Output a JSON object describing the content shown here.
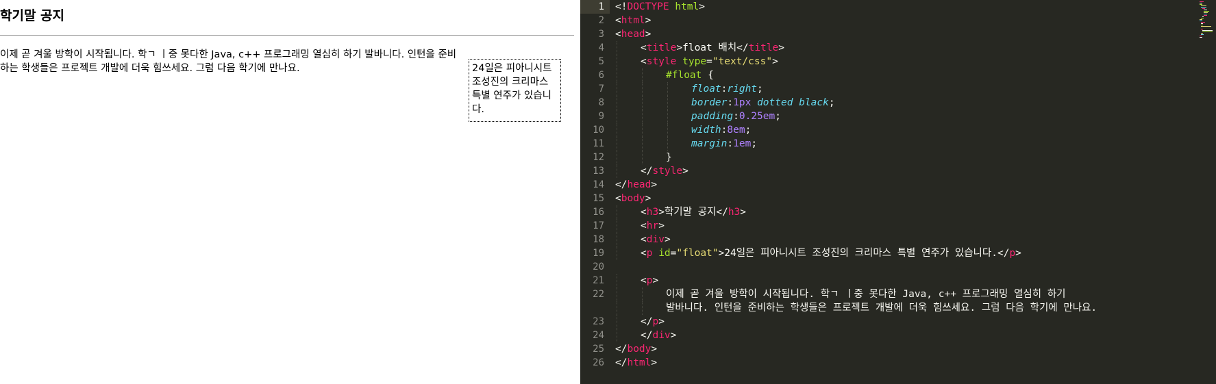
{
  "preview": {
    "heading": "학기말 공지",
    "body_text": "이제 곧 겨울 방학이 시작됩니다. 학ㄱ ㅣ중 못다한 Java, c++ 프로그래밍 열심히 하기 발바니다. 인턴을 준비하는 학생들은 프로젝트 개발에 더욱 힘쓰세요. 그럼 다음 학기에 만나요.",
    "float_text": "24일은 피아니시트 조성진의 크리마스 특별 연주가 있습니다."
  },
  "editor": {
    "active_line": 1,
    "theme": {
      "background": "#272822",
      "tag": "#f92672",
      "attr": "#a6e22e",
      "string": "#e6db74",
      "property": "#66d9ef",
      "number": "#ae81ff",
      "text": "#f8f8f2"
    },
    "lines": [
      {
        "n": 1,
        "indent": 0,
        "parts": [
          [
            "txt",
            "<!"
          ],
          [
            "tag",
            "DOCTYPE"
          ],
          [
            "txt",
            " "
          ],
          [
            "attr",
            "html"
          ],
          [
            "txt",
            ">"
          ]
        ]
      },
      {
        "n": 2,
        "indent": 0,
        "parts": [
          [
            "txt",
            "<"
          ],
          [
            "tag",
            "html"
          ],
          [
            "txt",
            ">"
          ]
        ]
      },
      {
        "n": 3,
        "indent": 0,
        "parts": [
          [
            "txt",
            "<"
          ],
          [
            "tag",
            "head"
          ],
          [
            "txt",
            ">"
          ]
        ]
      },
      {
        "n": 4,
        "indent": 1,
        "parts": [
          [
            "txt",
            "<"
          ],
          [
            "tag",
            "title"
          ],
          [
            "txt",
            ">float 배치</"
          ],
          [
            "tag",
            "title"
          ],
          [
            "txt",
            ">"
          ]
        ]
      },
      {
        "n": 5,
        "indent": 1,
        "parts": [
          [
            "txt",
            "<"
          ],
          [
            "tag",
            "style"
          ],
          [
            "txt",
            " "
          ],
          [
            "attr",
            "type"
          ],
          [
            "txt",
            "="
          ],
          [
            "str",
            "\"text/css\""
          ],
          [
            "txt",
            ">"
          ]
        ]
      },
      {
        "n": 6,
        "indent": 2,
        "parts": [
          [
            "attr",
            "#float"
          ],
          [
            "txt",
            " {"
          ]
        ]
      },
      {
        "n": 7,
        "indent": 3,
        "parts": [
          [
            "prop",
            "float"
          ],
          [
            "txt",
            ":"
          ],
          [
            "prop",
            "right"
          ],
          [
            "txt",
            ";"
          ]
        ]
      },
      {
        "n": 8,
        "indent": 3,
        "parts": [
          [
            "prop",
            "border"
          ],
          [
            "txt",
            ":"
          ],
          [
            "num",
            "1px"
          ],
          [
            "txt",
            " "
          ],
          [
            "prop",
            "dotted"
          ],
          [
            "txt",
            " "
          ],
          [
            "prop",
            "black"
          ],
          [
            "txt",
            ";"
          ]
        ]
      },
      {
        "n": 9,
        "indent": 3,
        "parts": [
          [
            "prop",
            "padding"
          ],
          [
            "txt",
            ":"
          ],
          [
            "num",
            "0.25em"
          ],
          [
            "txt",
            ";"
          ]
        ]
      },
      {
        "n": 10,
        "indent": 3,
        "parts": [
          [
            "prop",
            "width"
          ],
          [
            "txt",
            ":"
          ],
          [
            "num",
            "8em"
          ],
          [
            "txt",
            ";"
          ]
        ]
      },
      {
        "n": 11,
        "indent": 3,
        "parts": [
          [
            "prop",
            "margin"
          ],
          [
            "txt",
            ":"
          ],
          [
            "num",
            "1em"
          ],
          [
            "txt",
            ";"
          ]
        ]
      },
      {
        "n": 12,
        "indent": 2,
        "parts": [
          [
            "txt",
            "}"
          ]
        ]
      },
      {
        "n": 13,
        "indent": 1,
        "parts": [
          [
            "txt",
            "</"
          ],
          [
            "tag",
            "style"
          ],
          [
            "txt",
            ">"
          ]
        ]
      },
      {
        "n": 14,
        "indent": 0,
        "parts": [
          [
            "txt",
            "</"
          ],
          [
            "tag",
            "head"
          ],
          [
            "txt",
            ">"
          ]
        ]
      },
      {
        "n": 15,
        "indent": 0,
        "parts": [
          [
            "txt",
            "<"
          ],
          [
            "tag",
            "body"
          ],
          [
            "txt",
            ">"
          ]
        ]
      },
      {
        "n": 16,
        "indent": 1,
        "parts": [
          [
            "txt",
            "<"
          ],
          [
            "tag",
            "h3"
          ],
          [
            "txt",
            ">학기말 공지</"
          ],
          [
            "tag",
            "h3"
          ],
          [
            "txt",
            ">"
          ]
        ]
      },
      {
        "n": 17,
        "indent": 1,
        "parts": [
          [
            "txt",
            "<"
          ],
          [
            "tag",
            "hr"
          ],
          [
            "txt",
            ">"
          ]
        ]
      },
      {
        "n": 18,
        "indent": 1,
        "parts": [
          [
            "txt",
            "<"
          ],
          [
            "tag",
            "div"
          ],
          [
            "txt",
            ">"
          ]
        ]
      },
      {
        "n": 19,
        "indent": 1,
        "parts": [
          [
            "txt",
            "<"
          ],
          [
            "tag",
            "p"
          ],
          [
            "txt",
            " "
          ],
          [
            "attr",
            "id"
          ],
          [
            "txt",
            "="
          ],
          [
            "str",
            "\"float\""
          ],
          [
            "txt",
            ">24일은 피아니시트 조성진의 크리마스 특별 연주가 있습니다.</"
          ],
          [
            "tag",
            "p"
          ],
          [
            "txt",
            ">"
          ]
        ]
      },
      {
        "n": 20,
        "indent": 0,
        "parts": []
      },
      {
        "n": 21,
        "indent": 1,
        "parts": [
          [
            "txt",
            "<"
          ],
          [
            "tag",
            "p"
          ],
          [
            "txt",
            ">"
          ]
        ]
      },
      {
        "n": 22,
        "indent": 2,
        "parts": [
          [
            "txt",
            "이제 곧 겨울 방학이 시작됩니다. 학ㄱ ㅣ중 못다한 Java, c++ 프로그래밍 열심히 하기"
          ]
        ]
      },
      {
        "n": null,
        "indent": 2,
        "parts": [
          [
            "txt",
            "발바니다. 인턴을 준비하는 학생들은 프로젝트 개발에 더욱 힘쓰세요. 그럼 다음 학기에 만나요."
          ]
        ]
      },
      {
        "n": 23,
        "indent": 1,
        "parts": [
          [
            "txt",
            "</"
          ],
          [
            "tag",
            "p"
          ],
          [
            "txt",
            ">"
          ]
        ]
      },
      {
        "n": 24,
        "indent": 1,
        "parts": [
          [
            "txt",
            "</"
          ],
          [
            "tag",
            "div"
          ],
          [
            "txt",
            ">"
          ]
        ]
      },
      {
        "n": 25,
        "indent": 0,
        "parts": [
          [
            "txt",
            "</"
          ],
          [
            "tag",
            "body"
          ],
          [
            "txt",
            ">"
          ]
        ]
      },
      {
        "n": 26,
        "indent": 0,
        "parts": [
          [
            "txt",
            "</"
          ],
          [
            "tag",
            "html"
          ],
          [
            "txt",
            ">"
          ]
        ]
      }
    ]
  }
}
